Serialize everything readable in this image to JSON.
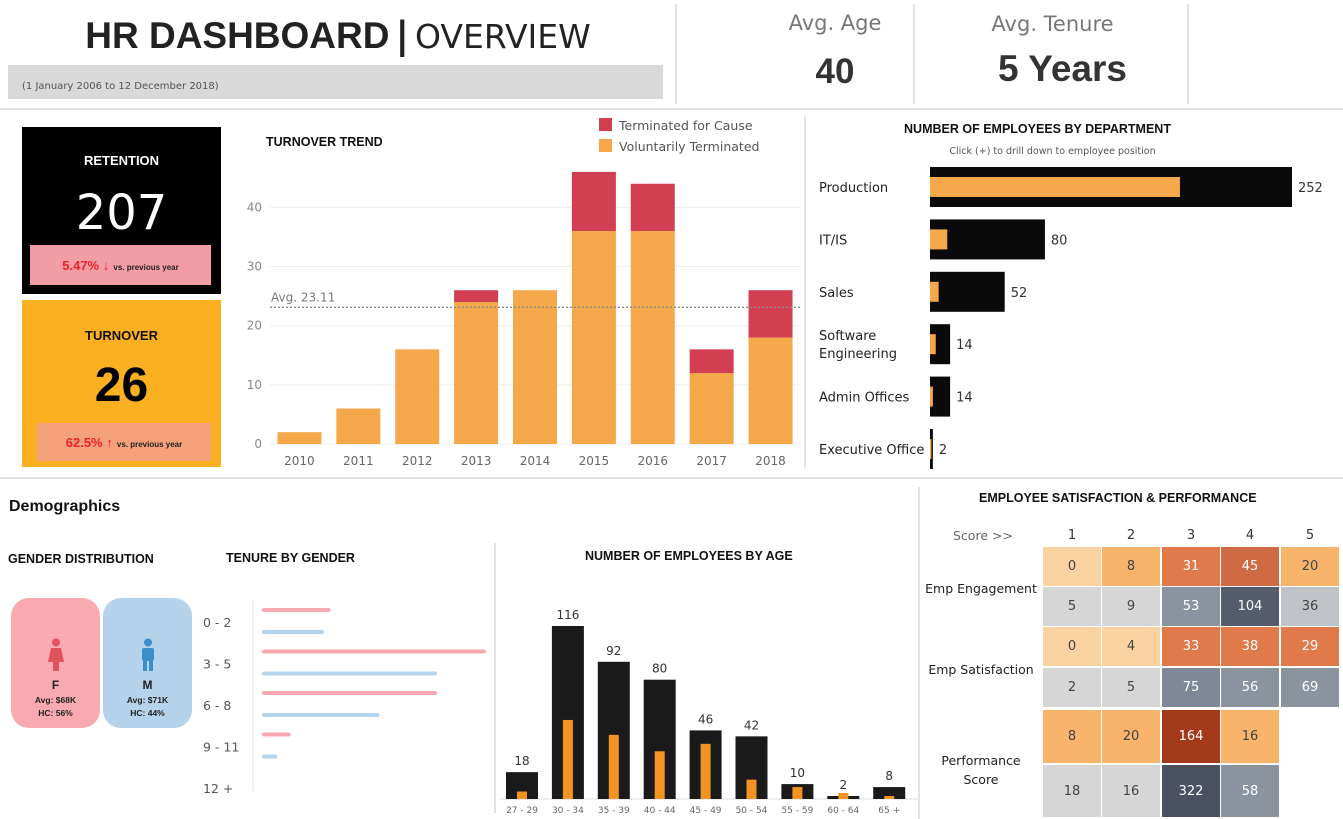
{
  "header": {
    "title_main": "HR DASHBOARD",
    "title_sep": "|",
    "title_sub": "OVERVIEW",
    "date_range": "(1 January 2006 to 12 December 2018)"
  },
  "kpis": {
    "avg_age_label": "Avg. Age",
    "avg_age_value": "40",
    "avg_tenure_label": "Avg. Tenure",
    "avg_tenure_value": "5 Years"
  },
  "retention": {
    "label": "RETENTION",
    "value": "207",
    "delta": "5.47% ↓",
    "delta_suffix": "vs. previous year",
    "bg": "#000000",
    "delta_bg": "#f29ca4"
  },
  "turnover": {
    "label": "TURNOVER",
    "value": "26",
    "delta": "62.5% ↑",
    "delta_suffix": "vs. previous year",
    "bg": "#fbb022",
    "delta_bg": "#f4a07a"
  },
  "demographics": {
    "title": "Demographics",
    "gender_title": "GENDER DISTRIBUTION",
    "female": {
      "letter": "F",
      "avg": "Avg: $68K",
      "hc": "HC: 56%",
      "color": "#f9aab1",
      "icon": "female-person-icon"
    },
    "male": {
      "letter": "M",
      "avg": "Avg: $71K",
      "hc": "HC: 44%",
      "color": "#b5d3ea",
      "icon": "male-person-icon"
    }
  },
  "chart_data": [
    {
      "id": "turnover_trend",
      "type": "bar",
      "title": "TURNOVER TREND",
      "categories": [
        "2010",
        "2011",
        "2012",
        "2013",
        "2014",
        "2015",
        "2016",
        "2017",
        "2018"
      ],
      "series": [
        {
          "name": "Voluntarily Terminated",
          "color": "#f5a84a",
          "values": [
            2,
            6,
            16,
            24,
            26,
            36,
            36,
            12,
            18
          ]
        },
        {
          "name": "Terminated for Cause",
          "color": "#d23f53",
          "values": [
            0,
            0,
            0,
            2,
            0,
            10,
            8,
            4,
            8
          ]
        }
      ],
      "stacked": true,
      "y_ticks": [
        0,
        10,
        20,
        30,
        40
      ],
      "ylim": [
        0,
        47
      ],
      "reference_line": {
        "label": "Avg. 23.11",
        "value": 23.11
      },
      "legend": "top-right"
    },
    {
      "id": "employees_by_department",
      "type": "bar",
      "orientation": "horizontal",
      "title": "NUMBER OF EMPLOYEES BY DEPARTMENT",
      "subtitle": "Click (+) to drill down to employee position",
      "categories": [
        "Production",
        "IT/IS",
        "Sales",
        "Software Engineering",
        "Admin Offices",
        "Executive Office"
      ],
      "values": [
        252,
        80,
        52,
        14,
        14,
        2
      ],
      "inner_values": [
        174,
        12,
        6,
        4,
        2,
        1
      ],
      "colors": {
        "outer": "#0a0a0a",
        "inner": "#f5a84a"
      }
    },
    {
      "id": "tenure_by_gender",
      "type": "bar",
      "orientation": "horizontal",
      "title": "TENURE BY GENDER",
      "categories": [
        "0 - 2",
        "3 - 5",
        "6 - 8",
        "9 - 11",
        "12 +"
      ],
      "series": [
        {
          "name": "F",
          "color": "#f7a8b0",
          "values": [
            30,
            100,
            78,
            12,
            0
          ]
        },
        {
          "name": "M",
          "color": "#b5d3ea",
          "values": [
            27,
            78,
            52,
            6,
            4
          ]
        }
      ]
    },
    {
      "id": "employees_by_age",
      "type": "bar",
      "title": "NUMBER OF EMPLOYEES BY AGE",
      "categories": [
        "27 - 29",
        "30 - 34",
        "35 - 39",
        "40 - 44",
        "45 - 49",
        "50 - 54",
        "55 - 59",
        "60 - 64",
        "65 +"
      ],
      "values": [
        18,
        116,
        92,
        80,
        46,
        42,
        10,
        2,
        8
      ],
      "inner_values": [
        5,
        53,
        43,
        32,
        37,
        13,
        8,
        4,
        2
      ],
      "colors": {
        "outer": "#1a1a1a",
        "inner": "#f39323"
      }
    },
    {
      "id": "satisfaction_performance",
      "type": "heatmap",
      "title": "EMPLOYEE SATISFACTION & PERFORMANCE",
      "score_label": "Score >>",
      "columns": [
        "1",
        "2",
        "3",
        "4",
        "5"
      ],
      "rows": [
        {
          "group": "Emp Engagement",
          "values": [
            0,
            8,
            31,
            45,
            20
          ],
          "palette": "orange"
        },
        {
          "group": "Emp Engagement",
          "values": [
            5,
            9,
            53,
            104,
            36
          ],
          "palette": "gray"
        },
        {
          "group": "Emp Satisfaction",
          "values": [
            0,
            4,
            33,
            38,
            29
          ],
          "palette": "orange"
        },
        {
          "group": "Emp Satisfaction",
          "values": [
            2,
            5,
            75,
            56,
            69
          ],
          "palette": "gray"
        },
        {
          "group": "Performance Score",
          "values": [
            8,
            20,
            164,
            16,
            null
          ],
          "palette": "orange"
        },
        {
          "group": "Performance Score",
          "values": [
            18,
            16,
            322,
            58,
            null
          ],
          "palette": "gray"
        }
      ],
      "group_labels": [
        "Emp Engagement",
        "Emp Satisfaction",
        "Performance\nScore"
      ]
    }
  ]
}
